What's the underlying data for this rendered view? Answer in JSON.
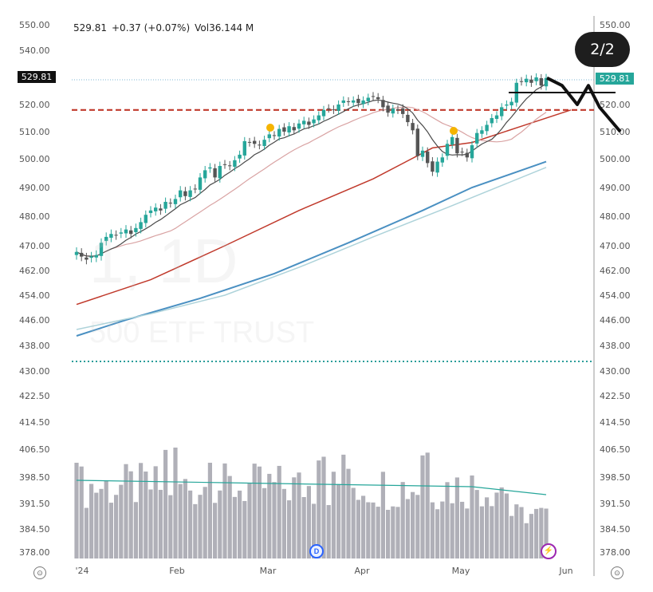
{
  "header": {
    "close": "529.81",
    "change": "+0.37 (+0.07%)",
    "volume_label": "Vol",
    "volume": "36.144 M"
  },
  "page_indicator": "2/2",
  "last_price_tag": "529.81",
  "crosshair_price_tag": "529.81",
  "watermark": {
    "symbol_interval": "1, 1D",
    "name": "500 ETF TRUST"
  },
  "badges": {
    "dividend": "D",
    "event": "⚡"
  },
  "colors": {
    "up": "#26a69a",
    "down": "#555555",
    "volume": "#b0b0b8",
    "ma_fast": "#4a4a4a",
    "ma_mid": "#d9a3a3",
    "ma_50": "#c0392b",
    "ma_100": "#4a90c2",
    "ma_200": "#aed3da",
    "vol_ma": "#26a69a",
    "resistance": "#c0392b",
    "marker": "#f5b400"
  },
  "chart_data": {
    "type": "candlestick",
    "y_axis_labels": [
      "550.00",
      "540.00",
      "529.81",
      "520.00",
      "510.00",
      "500.00",
      "490.00",
      "480.00",
      "470.00",
      "462.00",
      "454.00",
      "446.00",
      "438.00",
      "430.00",
      "422.50",
      "414.50",
      "406.50",
      "398.50",
      "391.50",
      "384.50",
      "378.00"
    ],
    "x_axis_labels": [
      "2024",
      "Feb",
      "Mar",
      "Apr",
      "May",
      "Jun"
    ],
    "closes": [
      468,
      466.5,
      465.5,
      466.5,
      467,
      471,
      473,
      474,
      473.5,
      474.5,
      475.5,
      474,
      476,
      478,
      480.5,
      482,
      483,
      482,
      485,
      484.5,
      486,
      489,
      487,
      489,
      489.5,
      493.5,
      496,
      497,
      493.5,
      497.5,
      498,
      497.5,
      499.5,
      501.5,
      506.5,
      506,
      505.5,
      505,
      507,
      509,
      508.5,
      511,
      510,
      512,
      510.5,
      513,
      514,
      512.5,
      514.5,
      516,
      518,
      518.5,
      518,
      520,
      521.5,
      521,
      521.5,
      520.5,
      521.5,
      522.5,
      523,
      522,
      519,
      517,
      518.5,
      518,
      516.5,
      513.5,
      510.5,
      501,
      503,
      498.5,
      495.5,
      499,
      500.5,
      505.5,
      508,
      502,
      502.5,
      500.5,
      505,
      509.5,
      510.5,
      512.5,
      515,
      516,
      519,
      520,
      521,
      528,
      528.5,
      529.5,
      528,
      530,
      527,
      529.8
    ],
    "y_range": [
      378,
      550
    ],
    "resistance_level": 518,
    "last_price": 529.81,
    "projected_path": [
      529.8,
      527,
      520,
      527,
      519,
      510
    ]
  }
}
